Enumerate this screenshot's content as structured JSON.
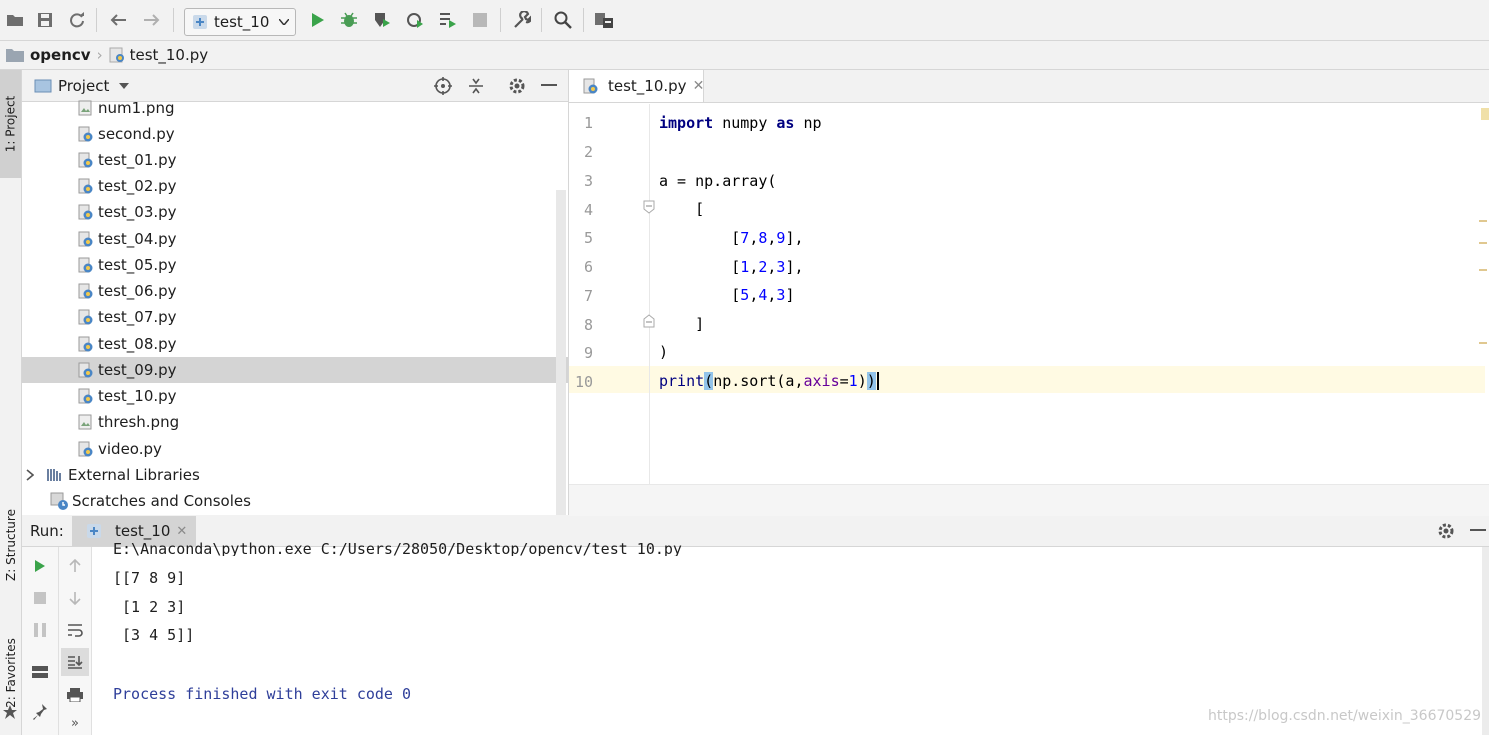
{
  "toolbar": {
    "run_config": "test_10"
  },
  "breadcrumb": {
    "project": "opencv",
    "file": "test_10.py"
  },
  "side_tabs": {
    "project": "1: Project",
    "structure": "Z: Structure",
    "favorites": "2: Favorites"
  },
  "project_panel": {
    "title": "Project",
    "files": [
      "num1.png",
      "second.py",
      "test_01.py",
      "test_02.py",
      "test_03.py",
      "test_04.py",
      "test_05.py",
      "test_06.py",
      "test_07.py",
      "test_08.py",
      "test_09.py",
      "test_10.py",
      "thresh.png",
      "video.py"
    ],
    "selected_file": "test_09.py",
    "external_libraries": "External Libraries",
    "scratches": "Scratches and Consoles"
  },
  "editor": {
    "tab_label": "test_10.py",
    "line_numbers": [
      "1",
      "2",
      "3",
      "4",
      "5",
      "6",
      "7",
      "8",
      "9",
      "10"
    ],
    "code": {
      "l1_kw1": "import",
      "l1_mod": " numpy ",
      "l1_kw2": "as",
      "l1_alias": " np",
      "l3": "a = np.array(",
      "l4": "    [",
      "l5_a": "        [",
      "l5_n1": "7",
      "l5_n2": "8",
      "l5_n3": "9",
      "l6_n1": "1",
      "l6_n2": "2",
      "l6_n3": "3",
      "l7_n1": "5",
      "l7_n2": "4",
      "l7_n3": "3",
      "l8": "    ]",
      "l9": ")",
      "l10_fn": "print",
      "l10_a": "np.sort(a,",
      "l10_kw": "axis",
      "l10_eq": "=",
      "l10_num": "1",
      "l10_close": ")"
    }
  },
  "run_panel": {
    "label": "Run:",
    "tab_label": "test_10",
    "output": [
      "E:\\Anaconda\\python.exe C:/Users/28050/Desktop/opencv/test_10.py",
      "[[7 8 9]",
      " [1 2 3]",
      " [3 4 5]]",
      "",
      "Process finished with exit code 0"
    ],
    "watermark": "https://blog.csdn.net/weixin_36670529"
  },
  "colors": {
    "run_green": "#3aa34a",
    "debug_green": "#499c54",
    "selection": "#d4d4d4",
    "caret_line": "#fffae3",
    "keyword": "#000080",
    "number": "#0000ff",
    "named_arg": "#660099"
  }
}
